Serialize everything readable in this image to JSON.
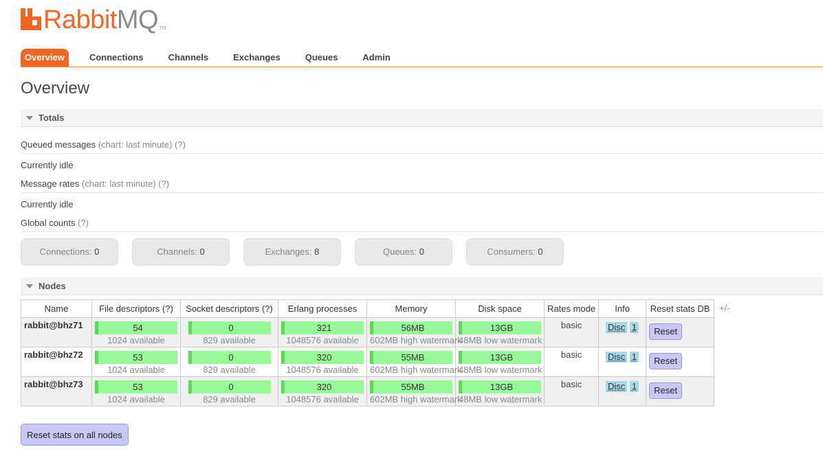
{
  "logo": {
    "rabbit": "Rabbit",
    "mq": "MQ",
    "tm": "TM"
  },
  "nav": [
    "Overview",
    "Connections",
    "Channels",
    "Exchanges",
    "Queues",
    "Admin"
  ],
  "page_title": "Overview",
  "totals": {
    "header": "Totals",
    "queued_label": "Queued messages",
    "queued_meta": "(chart: last minute) (?)",
    "queued_idle": "Currently idle",
    "rates_label": "Message rates",
    "rates_meta": "(chart: last minute) (?)",
    "rates_idle": "Currently idle",
    "global_label": "Global counts",
    "global_meta": "(?)"
  },
  "counts": [
    {
      "label": "Connections:",
      "value": "0"
    },
    {
      "label": "Channels:",
      "value": "0"
    },
    {
      "label": "Exchanges:",
      "value": "8"
    },
    {
      "label": "Queues:",
      "value": "0"
    },
    {
      "label": "Consumers:",
      "value": "0"
    }
  ],
  "nodes": {
    "header": "Nodes",
    "columns": [
      "Name",
      "File descriptors (?)",
      "Socket descriptors (?)",
      "Erlang processes",
      "Memory",
      "Disk space",
      "Rates mode",
      "Info",
      "Reset stats DB"
    ],
    "plus_minus": "+/-",
    "rows": [
      {
        "name": "rabbit@bhz71",
        "fd": "54",
        "fd_sub": "1024 available",
        "sock": "0",
        "sock_sub": "829 available",
        "erl": "321",
        "erl_sub": "1048576 available",
        "mem": "56MB",
        "mem_sub": "602MB high watermark",
        "disk": "13GB",
        "disk_sub": "48MB low watermark",
        "rates": "basic",
        "info_disc": "Disc",
        "info_num": "1",
        "reset": "Reset"
      },
      {
        "name": "rabbit@bhz72",
        "fd": "53",
        "fd_sub": "1024 available",
        "sock": "0",
        "sock_sub": "829 available",
        "erl": "320",
        "erl_sub": "1048576 available",
        "mem": "55MB",
        "mem_sub": "602MB high watermark",
        "disk": "13GB",
        "disk_sub": "48MB low watermark",
        "rates": "basic",
        "info_disc": "Disc",
        "info_num": "1",
        "reset": "Reset"
      },
      {
        "name": "rabbit@bhz73",
        "fd": "53",
        "fd_sub": "1024 available",
        "sock": "0",
        "sock_sub": "829 available",
        "erl": "320",
        "erl_sub": "1048576 available",
        "mem": "55MB",
        "mem_sub": "602MB high watermark",
        "disk": "13GB",
        "disk_sub": "48MB low watermark",
        "rates": "basic",
        "info_disc": "Disc",
        "info_num": "1",
        "reset": "Reset"
      }
    ]
  },
  "reset_all": "Reset stats on all nodes",
  "colors": {
    "accent": "#f26522",
    "bar_fill": "#98f898",
    "bar_edge": "#55dd55",
    "button": "#c8c8f8",
    "badge": "#a3d9e8"
  }
}
